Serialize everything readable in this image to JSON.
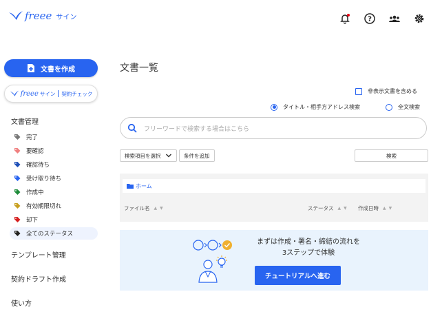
{
  "header": {
    "brand": "freee",
    "product": "サイン",
    "icons": [
      "bell-icon",
      "help-icon",
      "people-icon",
      "settings-icon"
    ],
    "notification_color": "#e60012"
  },
  "sidebar": {
    "create_label": "文書を作成",
    "contract_check": {
      "brand": "freee",
      "product": "サイン",
      "label": "契約チェック"
    },
    "documents_title": "文書管理",
    "statuses": [
      {
        "label": "完了",
        "color": "#777777"
      },
      {
        "label": "要確認",
        "color": "#f08080"
      },
      {
        "label": "確認待ち",
        "color": "#1e4fb8"
      },
      {
        "label": "受け取り待ち",
        "color": "#2864f0"
      },
      {
        "label": "作成中",
        "color": "#1e8c3a"
      },
      {
        "label": "有効期限切れ",
        "color": "#c8a020"
      },
      {
        "label": "却下",
        "color": "#d62020"
      },
      {
        "label": "全てのステータス",
        "color": "#222222"
      }
    ],
    "template_label": "テンプレート管理",
    "draft_label": "契約ドラフト作成",
    "howto_label": "使い方"
  },
  "main": {
    "title": "文書一覧",
    "hidden_docs_label": "非表示文書を含める",
    "radio_title_search": "タイトル・相手方アドレス検索",
    "radio_fulltext": "全文検索",
    "search_placeholder": "フリーワードで検索する場合はこちら",
    "select_item_label": "検索項目を選択",
    "add_condition_label": "条件を追加",
    "search_button": "検索",
    "home_label": "ホーム",
    "col_filename": "ファイル名",
    "col_status": "ステータス",
    "col_created": "作成日時"
  },
  "banner": {
    "line1": "まずは作成・署名・締結の流れを",
    "line2": "3ステップで体験",
    "button": "チュートリアルへ進む"
  },
  "colors": {
    "accent": "#2864f0",
    "banner_bg": "#e9f3fd"
  }
}
